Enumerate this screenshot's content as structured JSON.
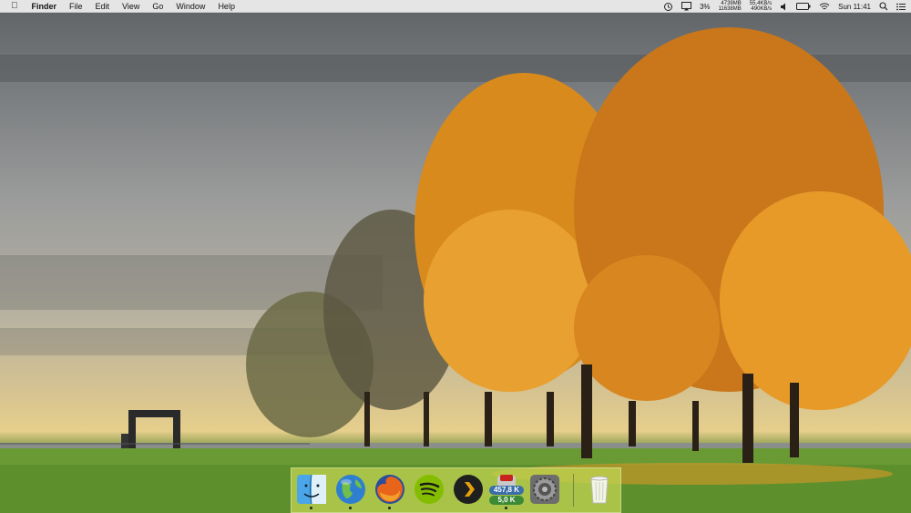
{
  "menubar": {
    "apple_icon": "apple-logo",
    "app_name": "Finder",
    "menus": [
      "File",
      "Edit",
      "View",
      "Go",
      "Window",
      "Help"
    ],
    "status": {
      "battery_percent": "3%",
      "memory_used": "4739MB",
      "memory_total": "11638MB",
      "net_down": "55,4KB/s",
      "net_up": "490KB/s",
      "clock": "Sun 11:41"
    }
  },
  "dock": {
    "apps": [
      {
        "name": "Finder",
        "icon": "finder-icon",
        "running": true
      },
      {
        "name": "Network",
        "icon": "globe-icon",
        "running": true
      },
      {
        "name": "Firefox",
        "icon": "firefox-icon",
        "running": true
      },
      {
        "name": "Spotify",
        "icon": "spotify-icon",
        "running": false
      },
      {
        "name": "Plex",
        "icon": "plex-icon",
        "running": false
      },
      {
        "name": "Transmission",
        "icon": "transmission-icon",
        "running": true,
        "badge_top": "457,8 K",
        "badge_bottom": "5,0 K"
      },
      {
        "name": "System Preferences",
        "icon": "gear-icon",
        "running": false
      },
      {
        "name": "Trash",
        "icon": "trash-icon",
        "running": false
      }
    ]
  }
}
